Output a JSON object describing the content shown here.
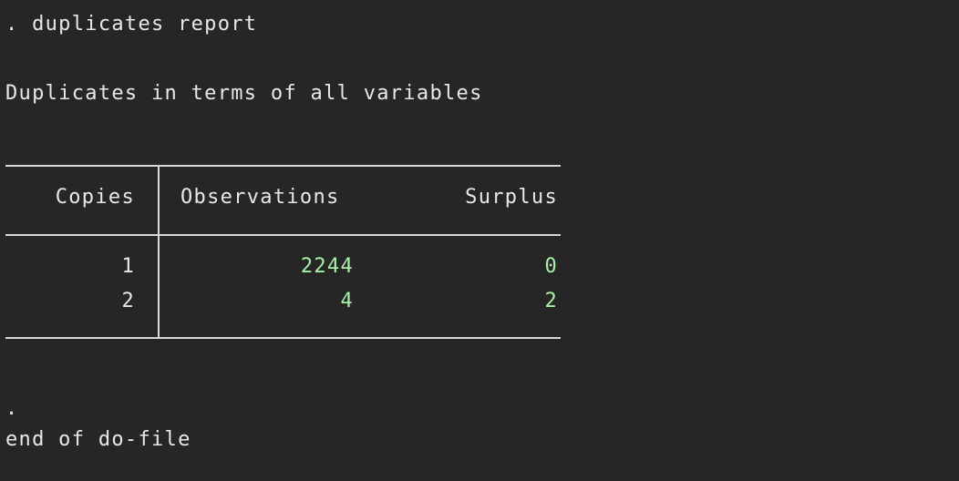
{
  "console": {
    "command": ". duplicates report",
    "subtitle": "Duplicates in terms of all variables",
    "prompt_dot": ".",
    "end_message": "end of do-file"
  },
  "table": {
    "headers": [
      "Copies",
      "Observations",
      "Surplus"
    ],
    "rows": [
      {
        "copies": "1",
        "observations": "2244",
        "surplus": "0"
      },
      {
        "copies": "2",
        "observations": "4",
        "surplus": "2"
      }
    ]
  },
  "colors": {
    "background": "#262626",
    "text": "#e8e8e8",
    "result_number": "#a8f0a8",
    "rule": "#d8d8d8"
  }
}
